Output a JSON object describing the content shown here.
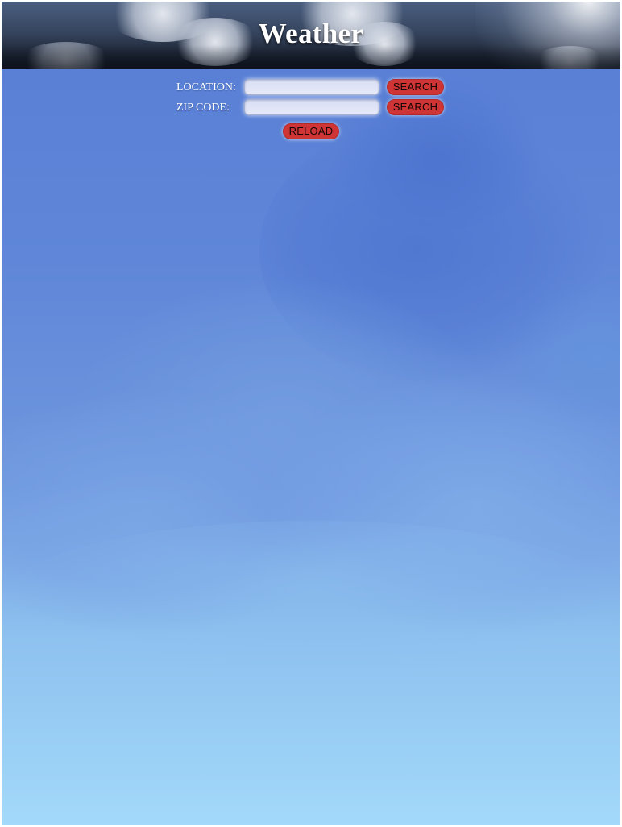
{
  "header": {
    "title": "Weather"
  },
  "form": {
    "location": {
      "label": "LOCATION:",
      "value": "",
      "search_label": "SEARCH"
    },
    "zip_code": {
      "label": "ZIP CODE:",
      "value": "",
      "search_label": "SEARCH"
    },
    "reload_label": "RELOAD"
  },
  "colors": {
    "button": "#cf3535",
    "sky_top": "#5a80d6",
    "sky_bottom": "#a3d9fa",
    "header_dark": "#1c2433"
  }
}
